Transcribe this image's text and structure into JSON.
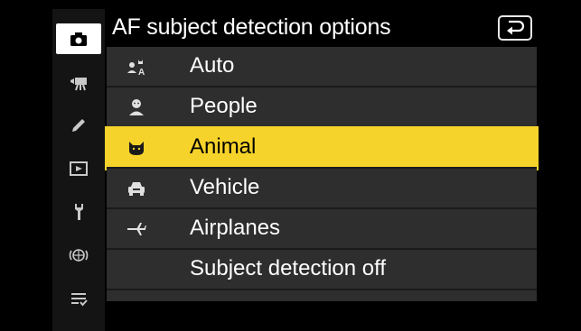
{
  "menu": {
    "title": "AF subject detection options",
    "back_icon": "return-arrow-icon"
  },
  "tabs": [
    {
      "icon": "camera-icon",
      "active": true
    },
    {
      "icon": "movie-camera-icon",
      "active": false
    },
    {
      "icon": "pencil-icon",
      "active": false
    },
    {
      "icon": "playback-icon",
      "active": false
    },
    {
      "icon": "wrench-icon",
      "active": false
    },
    {
      "icon": "network-icon",
      "active": false
    },
    {
      "icon": "my-menu-icon",
      "active": false
    }
  ],
  "options": [
    {
      "label": "Auto",
      "icon": "auto-subject-icon"
    },
    {
      "label": "People",
      "icon": "person-icon"
    },
    {
      "label": "Animal",
      "icon": "animal-icon",
      "selected": true
    },
    {
      "label": "Vehicle",
      "icon": "car-icon"
    },
    {
      "label": "Airplanes",
      "icon": "airplane-icon"
    },
    {
      "label": "Subject detection off",
      "icon": ""
    }
  ],
  "colors": {
    "highlight": "#f6d32a",
    "row_bg": "#2e2e2e",
    "background": "#000000"
  }
}
